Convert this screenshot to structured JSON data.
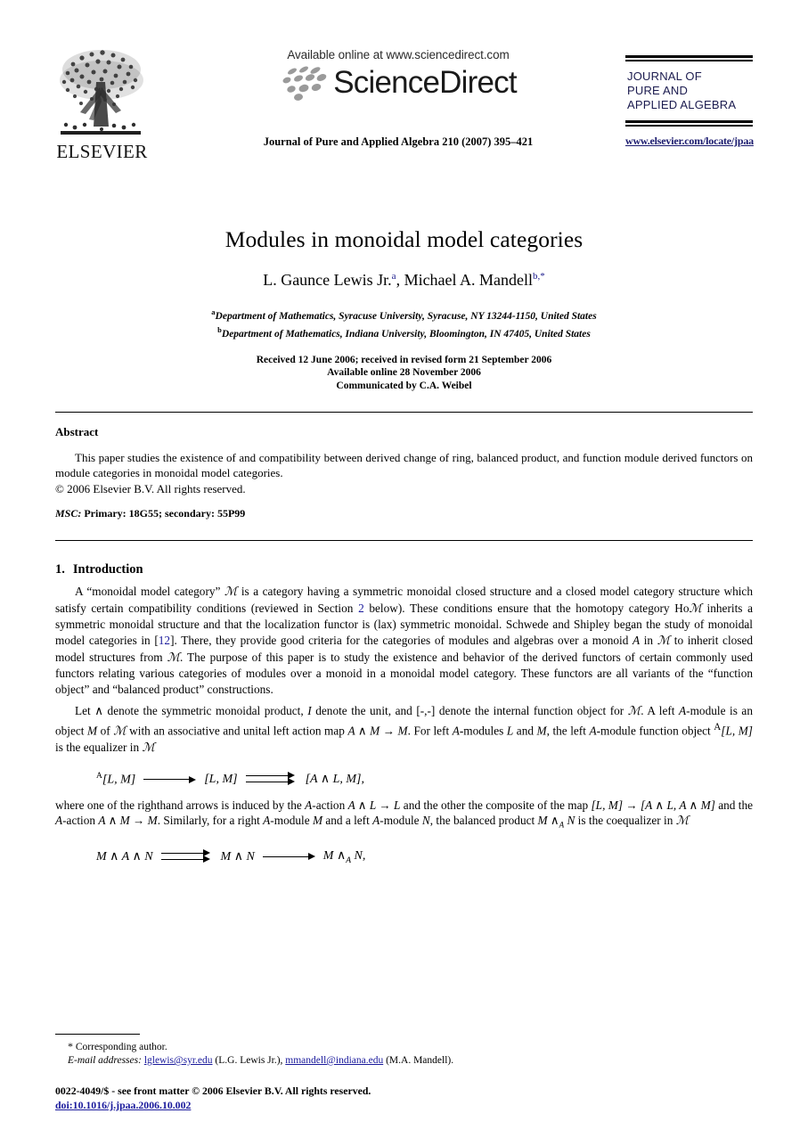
{
  "header": {
    "publisher_name": "ELSEVIER",
    "available_online": "Available online at www.sciencedirect.com",
    "sciencedirect_wordmark": "ScienceDirect",
    "journal_reference": "Journal of Pure and Applied Algebra 210 (2007) 395–421",
    "journal_box_title_line1": "JOURNAL OF",
    "journal_box_title_line2": "PURE AND",
    "journal_box_title_line3": "APPLIED ALGEBRA",
    "journal_url": "www.elsevier.com/locate/jpaa"
  },
  "article": {
    "title": "Modules in monoidal model categories",
    "authors": [
      {
        "name": "L. Gaunce Lewis Jr.",
        "marker": "a",
        "separator": ", "
      },
      {
        "name": "Michael A. Mandell",
        "marker": "b,*",
        "separator": ""
      }
    ],
    "affiliations": [
      {
        "marker": "a",
        "text": "Department of Mathematics, Syracuse University, Syracuse, NY 13244-1150, United States"
      },
      {
        "marker": "b",
        "text": "Department of Mathematics, Indiana University, Bloomington, IN 47405, United States"
      }
    ],
    "dates": [
      "Received 12 June 2006; received in revised form 21 September 2006",
      "Available online 28 November 2006",
      "Communicated by C.A. Weibel"
    ]
  },
  "abstract": {
    "heading": "Abstract",
    "text": "This paper studies the existence of and compatibility between derived change of ring, balanced product, and function module derived functors on module categories in monoidal model categories.",
    "copyright": "© 2006 Elsevier B.V. All rights reserved.",
    "msc_label": "MSC:",
    "msc_value": "Primary: 18G55; secondary: 55P99"
  },
  "body": {
    "section_number": "1.",
    "section_title": "Introduction",
    "para1_a": "A “monoidal model category” ",
    "para1_b": " is a category having a symmetric monoidal closed structure and a closed model category structure which satisfy certain compatibility conditions (reviewed in Section ",
    "para1_ref_section": "2",
    "para1_c": " below). These conditions ensure that the homotopy category Ho",
    "para1_d": " inherits a symmetric monoidal structure and that the localization functor is (lax) symmetric monoidal. Schwede and Shipley began the study of monoidal model categories in [",
    "para1_ref_12": "12",
    "para1_e": "]. There, they provide good criteria for the categories of modules and algebras over a monoid ",
    "para1_f": " in ",
    "para1_g": " to inherit closed model structures from ",
    "para1_h": ". The purpose of this paper is to study the existence and behavior of the derived functors of certain commonly used functors relating various categories of modules over a monoid in a monoidal model category. These functors are all variants of the “function object” and “balanced product” constructions.",
    "para2_a": "Let ∧ denote the symmetric monoidal product, ",
    "para2_b": " denote the unit, and [-,-] denote the internal function object for ",
    "para2_c": ". A left ",
    "para2_d": "-module is an object ",
    "para2_e": " of ",
    "para2_f": " with an associative and unital left action map ",
    "para2_g": ". For left ",
    "para2_h": "-modules ",
    "para2_i": " and ",
    "para2_j": ", the left ",
    "para2_k": "-module function object ",
    "para2_l": " is the equalizer in ",
    "para3_a": "where one of the righthand arrows is induced by the ",
    "para3_b": "-action ",
    "para3_c": " and the other the composite of the map ",
    "para3_d": " and the ",
    "para3_e": "-action ",
    "para3_f": ". Similarly, for a right ",
    "para3_g": "-module ",
    "para3_h": " and a left ",
    "para3_i": "-module ",
    "para3_j": ", the balanced product ",
    "para3_k": " is the coequalizer in ",
    "symbols": {
      "script_M": "ℳ",
      "italic_A": "A",
      "italic_I": "I",
      "italic_M": "M",
      "italic_L": "L",
      "italic_N": "N",
      "wedge": "∧",
      "arrow": "→"
    },
    "equation1": {
      "term1_sup": "A",
      "term1": "[L, M]",
      "term2": "[L, M]",
      "term3": "[A ∧ L, M],"
    },
    "equation2": {
      "term1": "M ∧ A ∧ N",
      "term2": "M ∧ N",
      "term3_main": "M ∧",
      "term3_sub": "A",
      "term3_tail": " N,"
    },
    "inline": {
      "action_map": "A ∧ M → M",
      "func_obj_sup": "A",
      "func_obj": "[L, M]",
      "a_action_AL": "A ∧ L → L",
      "map_LM": "[L, M] → [A ∧ L, A ∧ M]",
      "a_action_AM": "A ∧ M → M",
      "balanced_main": "M ∧",
      "balanced_sub": "A",
      "balanced_tail": " N"
    }
  },
  "footnotes": {
    "corresponding": "Corresponding author.",
    "corresponding_marker": "*",
    "email_label": "E-mail addresses:",
    "emails": [
      {
        "address": "lglewis@syr.edu",
        "owner": " (L.G. Lewis Jr.), "
      },
      {
        "address": "mmandell@indiana.edu",
        "owner": " (M.A. Mandell)."
      }
    ]
  },
  "footer": {
    "issn_line": "0022-4049/$ - see front matter © 2006 Elsevier B.V. All rights reserved.",
    "doi": "doi:10.1016/j.jpaa.2006.10.002"
  },
  "colors": {
    "link": "#1a1a9c",
    "journal_navy": "#1b1b4f"
  }
}
